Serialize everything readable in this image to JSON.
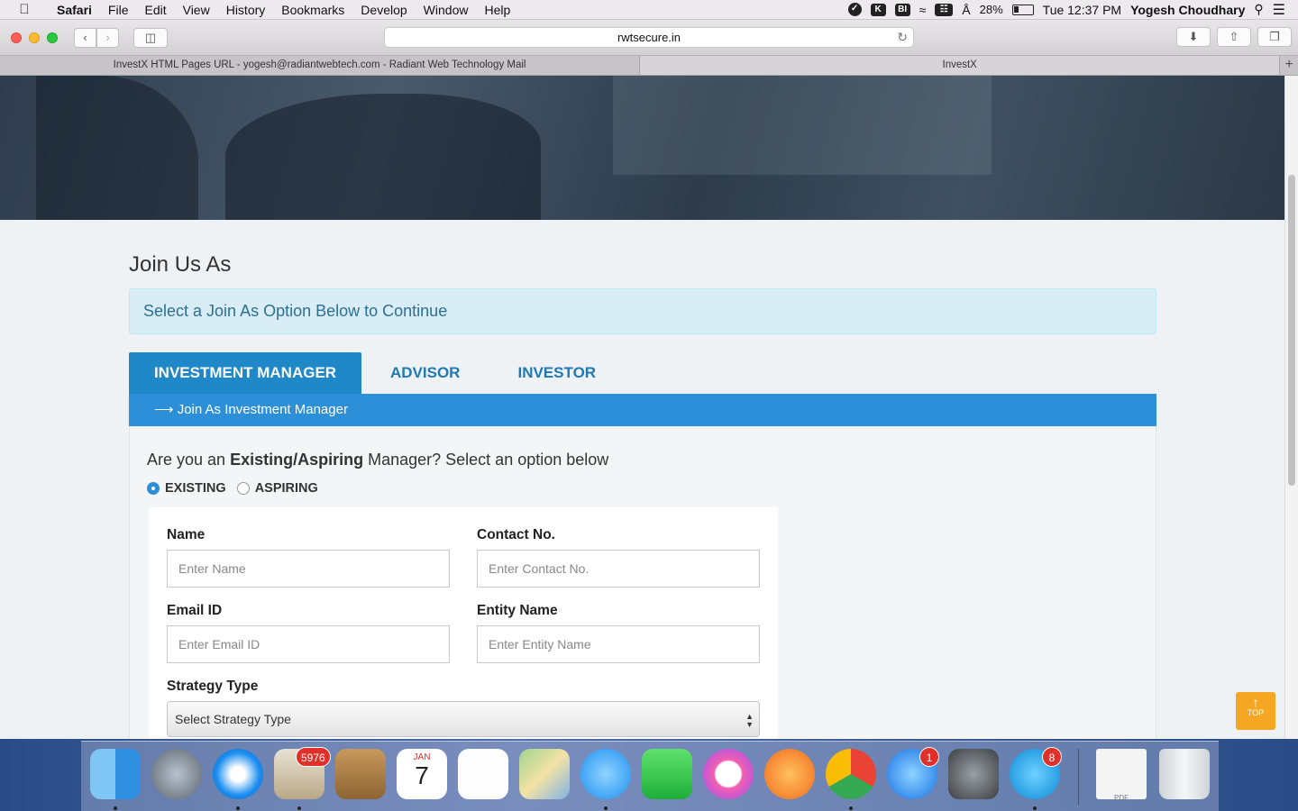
{
  "menubar": {
    "app": "Safari",
    "items": [
      "File",
      "Edit",
      "View",
      "History",
      "Bookmarks",
      "Develop",
      "Window",
      "Help"
    ],
    "battery": "28%",
    "clock": "Tue 12:37 PM",
    "user": "Yogesh Choudhary"
  },
  "browser": {
    "url": "rwtsecure.in",
    "tabs": [
      {
        "title": "InvestX HTML Pages URL - yogesh@radiantwebtech.com - Radiant Web Technology Mail"
      },
      {
        "title": "InvestX"
      }
    ]
  },
  "page": {
    "heading": "Join Us As",
    "alert": "Select a Join As Option Below to Continue",
    "nav_tabs": [
      "INVESTMENT MANAGER",
      "ADVISOR",
      "INVESTOR"
    ],
    "panel_title": "Join As Investment Manager",
    "question_pre": "Are you an ",
    "question_bold": "Existing/Aspiring",
    "question_post": " Manager? Select an option below",
    "radio_options": [
      "EXISTING",
      "ASPIRING"
    ],
    "selected_option": "EXISTING",
    "form": {
      "name_label": "Name",
      "name_placeholder": "Enter Name",
      "contact_label": "Contact No.",
      "contact_placeholder": "Enter Contact No.",
      "email_label": "Email ID",
      "email_placeholder": "Enter Email ID",
      "entity_label": "Entity Name",
      "entity_placeholder": "Enter Entity Name",
      "strategy_label": "Strategy Type",
      "strategy_selected": "Select Strategy Type"
    },
    "top_button": "TOP"
  },
  "dock": {
    "mail_badge": "5976",
    "calendar_month": "JAN",
    "calendar_day": "7",
    "appstore_badge": "1",
    "skype_badge": "8",
    "pdf_label": "PDF"
  }
}
